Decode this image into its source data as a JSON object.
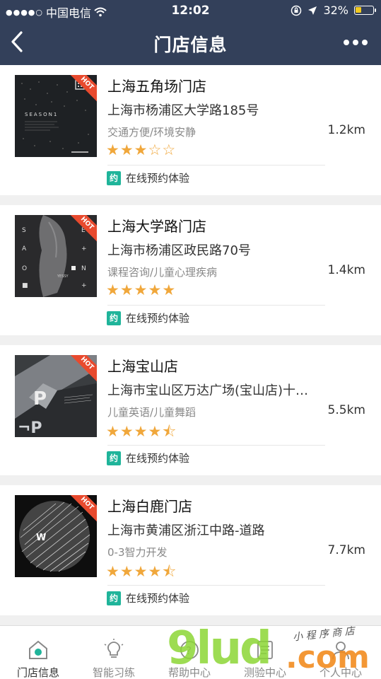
{
  "status_bar": {
    "carrier": "中国电信",
    "time": "12:02",
    "battery": "32%",
    "battery_level": 0.32
  },
  "nav": {
    "title": "门店信息"
  },
  "stores": [
    {
      "name": "上海五角场门店",
      "address": "上海市杨浦区大学路185号",
      "tags": "交通方便/环境安静",
      "distance": "1.2km",
      "rating": 3,
      "hot": "HOT",
      "booking": "在线预约体验",
      "booking_badge": "约"
    },
    {
      "name": "上海大学路门店",
      "address": "上海市杨浦区政民路70号",
      "tags": "课程咨询/儿童心理疾病",
      "distance": "1.4km",
      "rating": 5,
      "hot": "HOT",
      "booking": "在线预约体验",
      "booking_badge": "约"
    },
    {
      "name": "上海宝山店",
      "address": "上海市宝山区万达广场(宝山店)十…",
      "tags": "儿童英语/儿童舞蹈",
      "distance": "5.5km",
      "rating": 4.5,
      "hot": "HOT",
      "booking": "在线预约体验",
      "booking_badge": "约"
    },
    {
      "name": "上海白鹿门店",
      "address": "上海市黄浦区浙江中路-道路",
      "tags": "0-3智力开发",
      "distance": "7.7km",
      "rating": 4.5,
      "hot": "HOT",
      "booking": "在线预约体验",
      "booking_badge": "约"
    }
  ],
  "tabs": [
    {
      "label": "门店信息",
      "icon": "store-icon",
      "active": true
    },
    {
      "label": "智能习练",
      "icon": "bulb-icon",
      "active": false
    },
    {
      "label": "帮助中心",
      "icon": "help-icon",
      "active": false
    },
    {
      "label": "测验中心",
      "icon": "quiz-icon",
      "active": false
    },
    {
      "label": "个人中心",
      "icon": "user-icon",
      "active": false
    }
  ],
  "watermark": {
    "brand": "9lud",
    "domain": ".com",
    "caption": "小 程 序 商 店"
  },
  "colors": {
    "header": "#33405a",
    "accent": "#1fb49a",
    "star": "#f0a73b",
    "hot": "#e84a2e"
  }
}
